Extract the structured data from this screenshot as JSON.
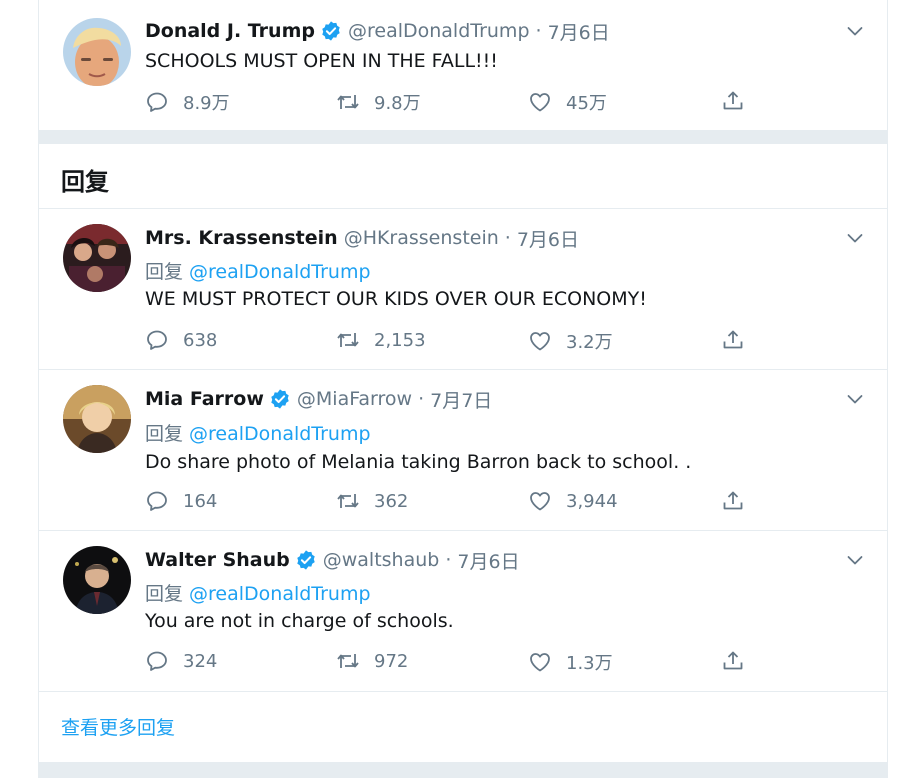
{
  "main_tweet": {
    "name": "Donald J. Trump",
    "verified": true,
    "handle": "@realDonaldTrump",
    "time": "7月6日",
    "text": "SCHOOLS MUST OPEN IN THE FALL!!!",
    "replies": "8.9万",
    "retweets": "9.8万",
    "likes": "45万"
  },
  "replies_section_title": "回复",
  "replies": [
    {
      "name": "Mrs. Krassenstein",
      "verified": false,
      "handle": "@HKrassenstein",
      "time": "7月6日",
      "replying_label": "回复",
      "replying_to": "@realDonaldTrump",
      "text": "WE MUST PROTECT OUR KIDS OVER OUR ECONOMY!",
      "replies": "638",
      "retweets": "2,153",
      "likes": "3.2万"
    },
    {
      "name": "Mia Farrow",
      "verified": true,
      "handle": "@MiaFarrow",
      "time": "7月7日",
      "replying_label": "回复",
      "replying_to": "@realDonaldTrump",
      "text": "Do share photo of Melania taking Barron back to school. .",
      "replies": "164",
      "retweets": "362",
      "likes": "3,944"
    },
    {
      "name": "Walter Shaub",
      "verified": true,
      "handle": "@waltshaub",
      "time": "7月6日",
      "replying_label": "回复",
      "replying_to": "@realDonaldTrump",
      "text": "You are not in charge of schools.",
      "replies": "324",
      "retweets": "972",
      "likes": "1.3万"
    }
  ],
  "show_more": "查看更多回复",
  "dot": "·",
  "colors": {
    "accent": "#1da1f2",
    "secondary_text": "#657786",
    "divider": "#e6ecf0"
  },
  "icons": [
    "reply-icon",
    "retweet-icon",
    "like-icon",
    "share-icon",
    "verified-badge-icon",
    "chevron-down-icon"
  ]
}
